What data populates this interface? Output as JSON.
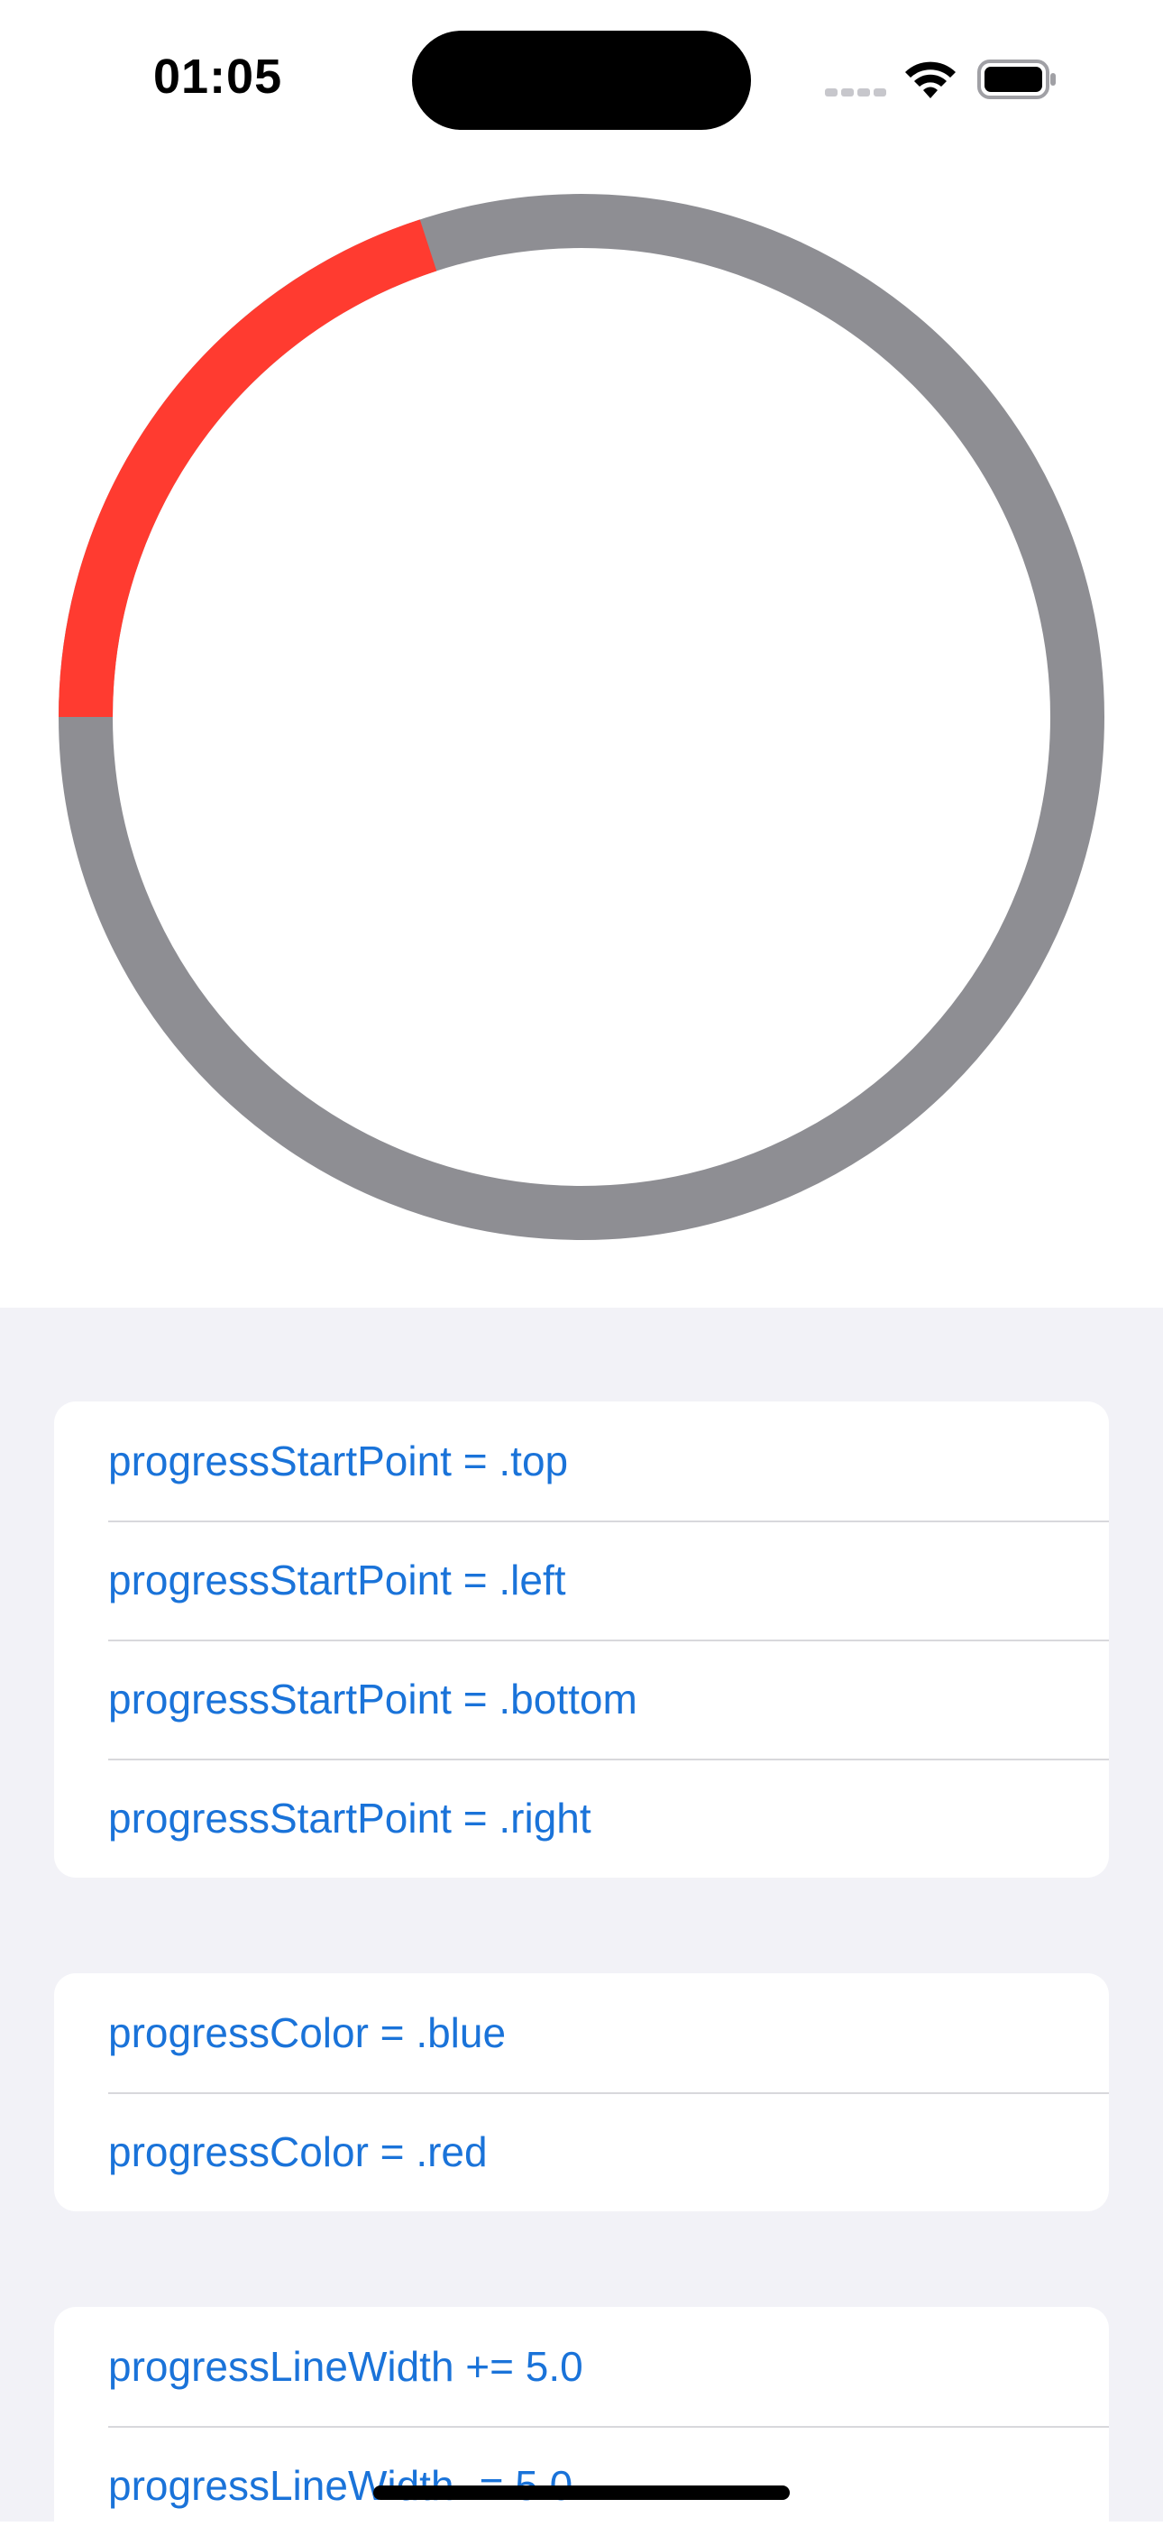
{
  "status": {
    "time": "01:05"
  },
  "progress_ring": {
    "progress": 0.2,
    "start_point": "left",
    "progress_color": "#ff3b30",
    "track_color": "#8e8e93"
  },
  "groups": {
    "start_point": [
      {
        "label": "progressStartPoint = .top"
      },
      {
        "label": "progressStartPoint = .left"
      },
      {
        "label": "progressStartPoint = .bottom"
      },
      {
        "label": "progressStartPoint = .right"
      }
    ],
    "color": [
      {
        "label": "progressColor = .blue"
      },
      {
        "label": "progressColor = .red"
      }
    ],
    "line_width": [
      {
        "label": "progressLineWidth += 5.0"
      },
      {
        "label": "progressLineWidth -= 5.0"
      }
    ]
  },
  "colors": {
    "accent": "#1a73d9",
    "background": "#f2f2f7"
  }
}
